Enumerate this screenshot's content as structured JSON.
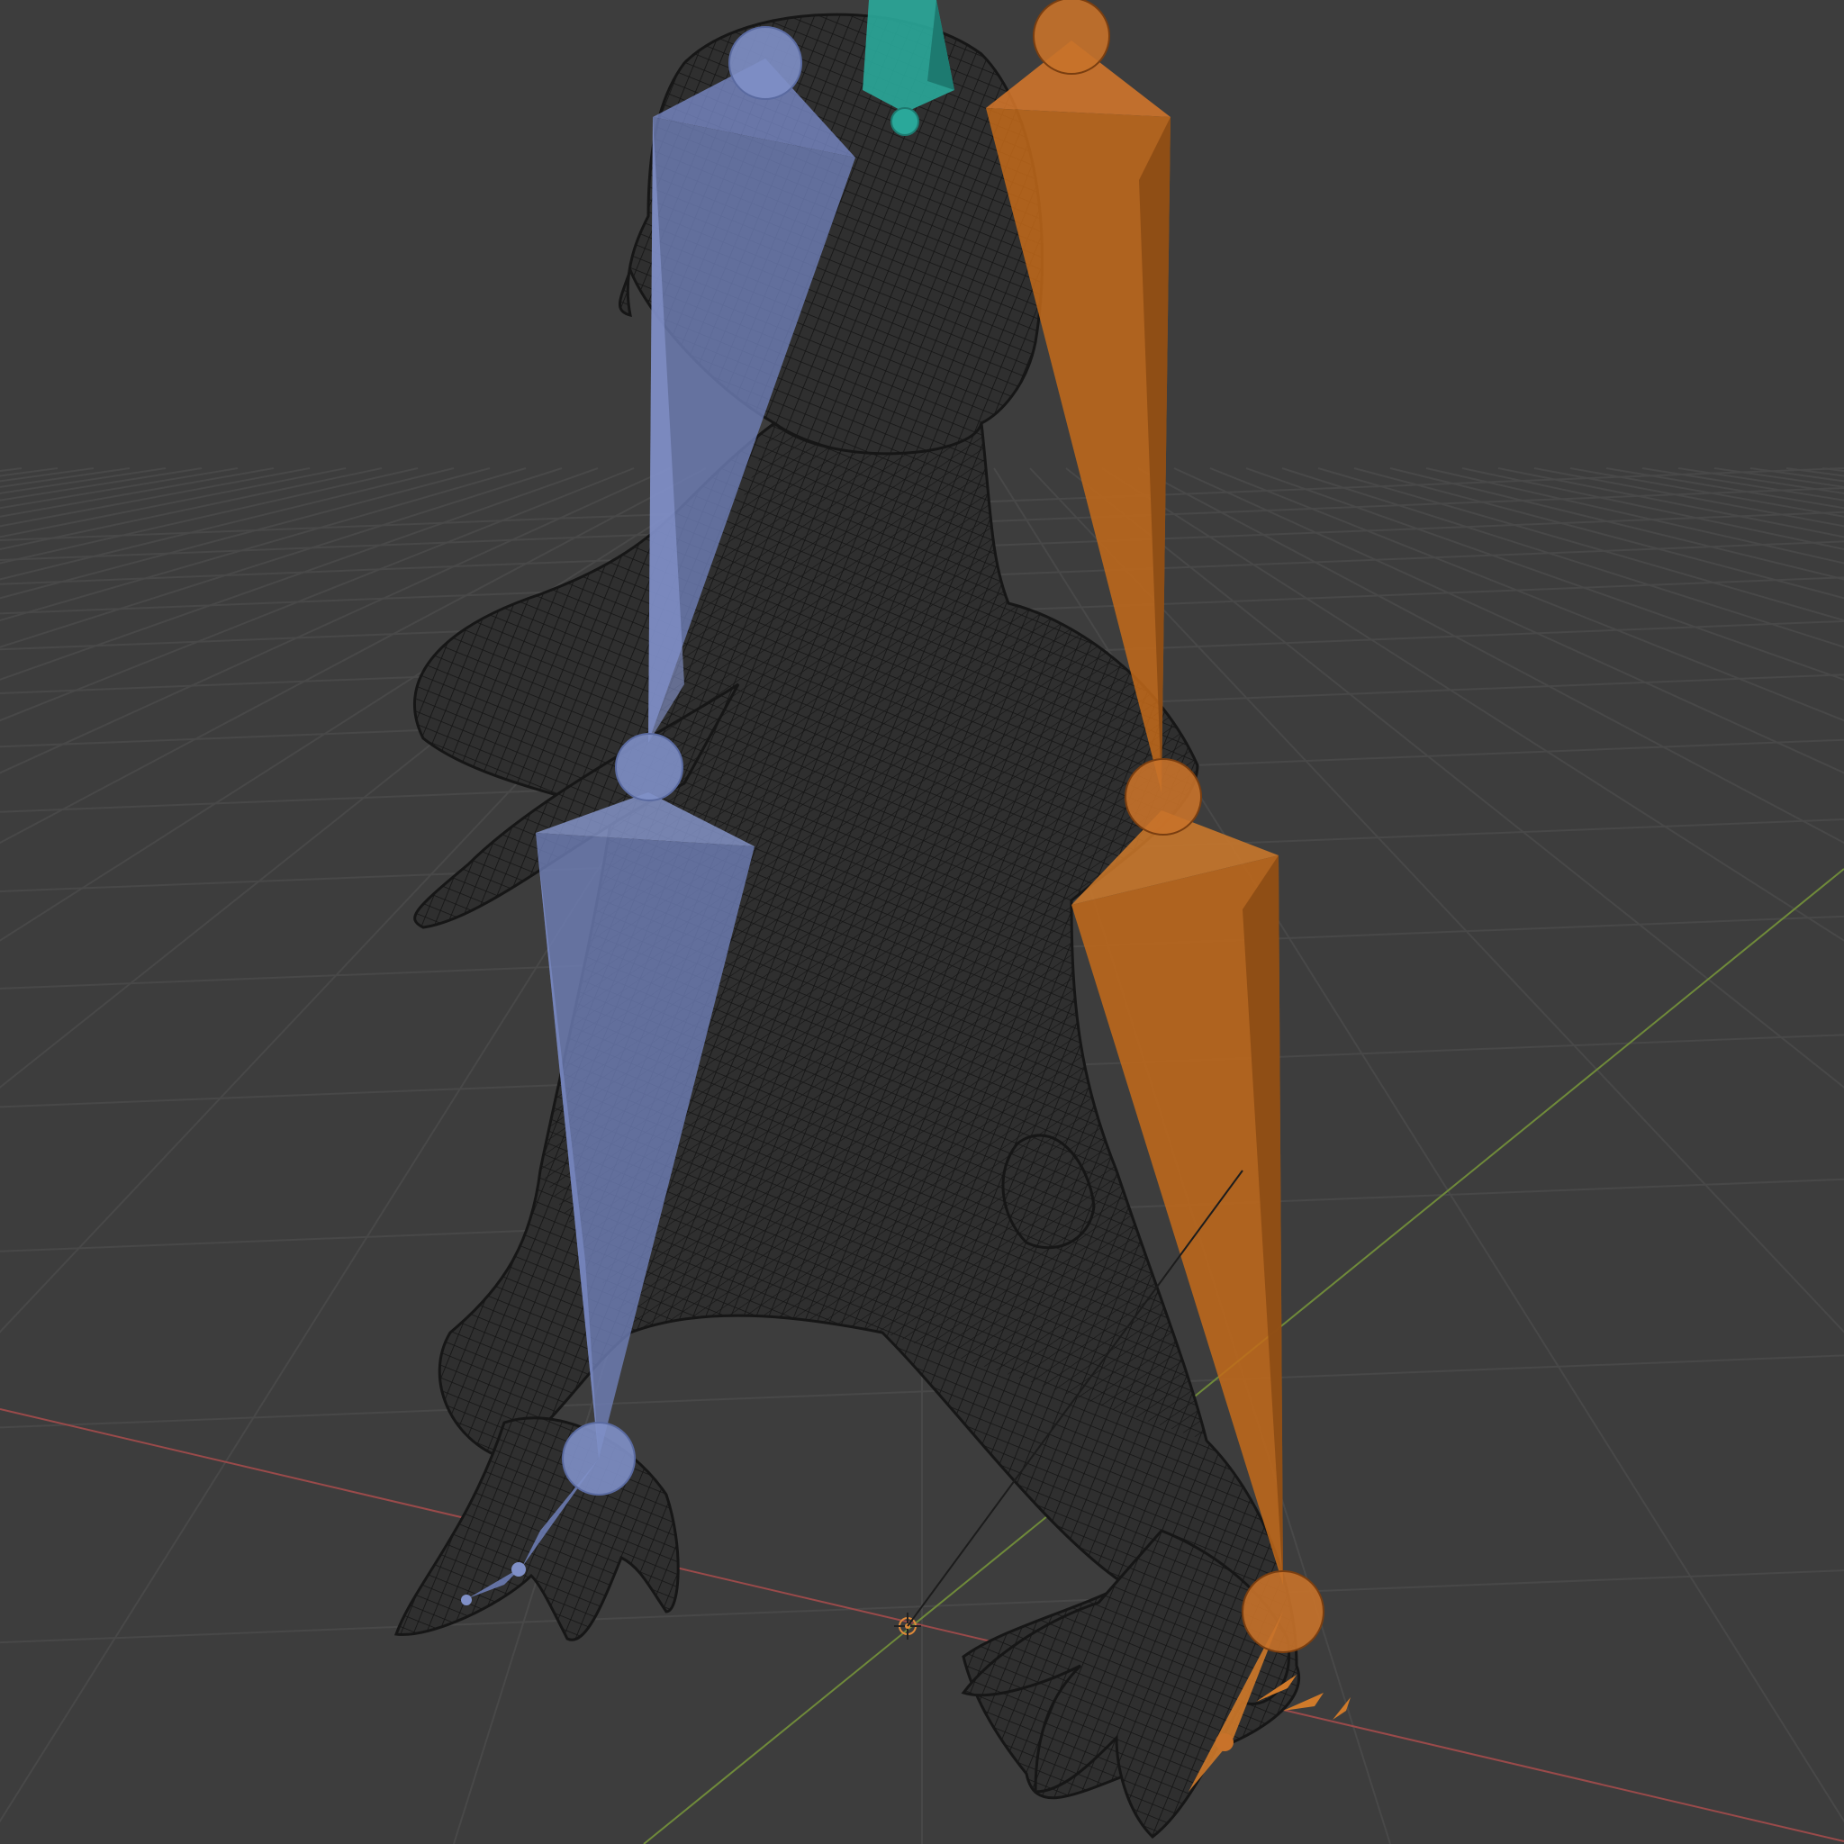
{
  "viewport": {
    "kind": "3d-viewport",
    "shading": "wireframe",
    "background_color": "#3d3d3d",
    "grid_color": "#484848",
    "x_axis_color": "#9a4a4a",
    "y_axis_color": "#6f8a3a",
    "mesh_wire_color": "#141414"
  },
  "armature": {
    "bones": [
      {
        "name": "left-upper-leg-bone",
        "color": "#6f7fb8",
        "selected": false
      },
      {
        "name": "left-lower-leg-bone",
        "color": "#6f7fb8",
        "selected": false
      },
      {
        "name": "left-foot-bone",
        "color": "#6f7fb8",
        "selected": false
      },
      {
        "name": "right-upper-leg-bone",
        "color": "#c36a1a",
        "selected": true
      },
      {
        "name": "right-lower-leg-bone",
        "color": "#c36a1a",
        "selected": true
      },
      {
        "name": "right-foot-bone",
        "color": "#c36a1a",
        "selected": true
      },
      {
        "name": "head-bone",
        "color": "#2aa89a",
        "selected": false
      }
    ]
  },
  "world_origin": {
    "icon": "origin-crosshair-icon",
    "color": "#e08a3a"
  }
}
